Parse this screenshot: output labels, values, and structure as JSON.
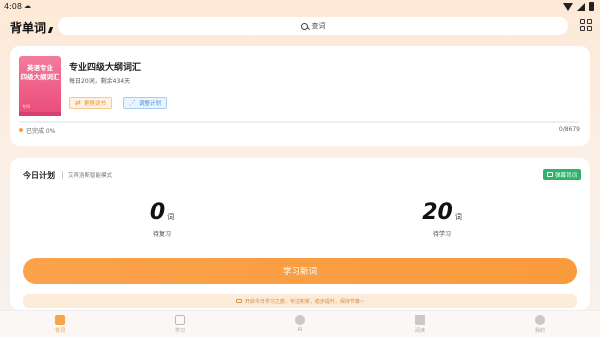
{
  "status_bar": {
    "time": "4:08"
  },
  "header": {
    "brand": "背单词",
    "search_placeholder": "查词"
  },
  "book": {
    "cover_title_line1": "英语专业",
    "cover_title_line2": "四级大纲词汇",
    "cover_sub": "专四",
    "title": "专业四级大纲词汇",
    "info": "每日20词，剩余434天",
    "change_label": "更换词书",
    "adjust_label": "调整计划",
    "progress_percent": 0,
    "progress_label": "已完成 0%",
    "progress_count": "0/8679"
  },
  "plan": {
    "title": "今日计划",
    "mode": "艾宾浩斯智能模式",
    "barrage_label": "弹幕背词",
    "review_count": "0",
    "review_unit": "词",
    "review_label": "待复习",
    "learn_count": "20",
    "learn_unit": "词",
    "learn_label": "待学习",
    "learn_button": "学习新词",
    "tip": "开启今日学习之旅，专注积累，稳步提升，保持节奏~"
  },
  "nav": {
    "items": [
      {
        "label": "背词",
        "icon": "book-icon"
      },
      {
        "label": "学习",
        "icon": "chart-icon"
      },
      {
        "label": "AI",
        "icon": "ai-icon"
      },
      {
        "label": "阅读",
        "icon": "read-icon"
      },
      {
        "label": "我的",
        "icon": "profile-icon"
      }
    ]
  },
  "colors": {
    "accent": "#f99a3d",
    "green": "#2fb36a",
    "blue": "#3b8ee4"
  }
}
